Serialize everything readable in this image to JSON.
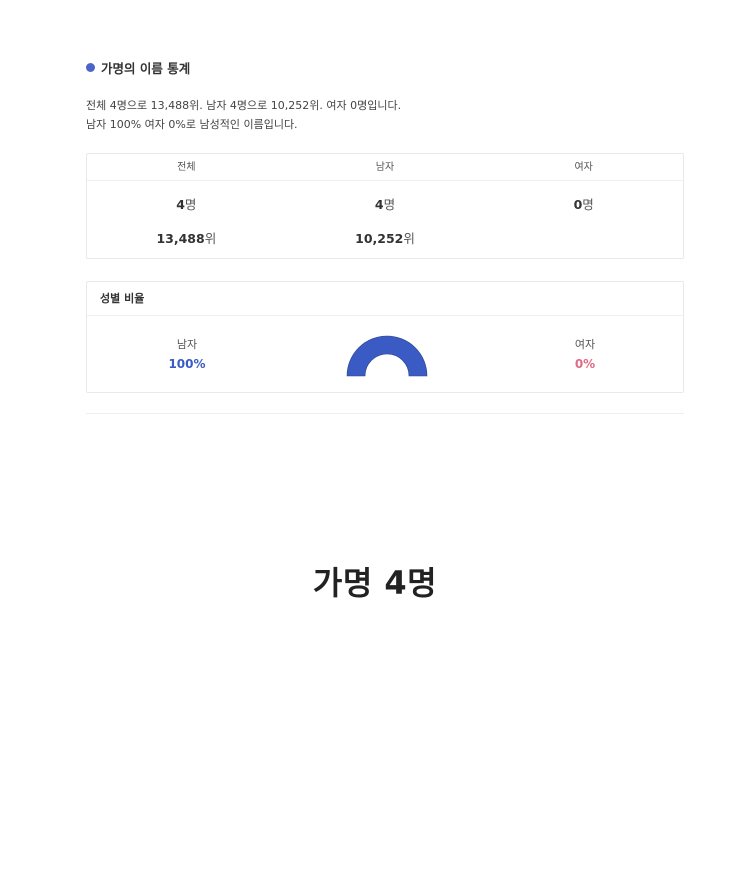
{
  "section": {
    "title": "가명의 이름 통계"
  },
  "summary": {
    "line1": "전체 4명으로 13,488위. 남자 4명으로 10,252위. 여자 0명입니다.",
    "line2": "남자 100% 여자 0%로 남성적인 이름입니다."
  },
  "stats": {
    "headers": [
      "전체",
      "남자",
      "여자"
    ],
    "counts": [
      {
        "num": "4",
        "unit": "명"
      },
      {
        "num": "4",
        "unit": "명"
      },
      {
        "num": "0",
        "unit": "명"
      }
    ],
    "ranks": [
      {
        "num": "13,488",
        "unit": "위"
      },
      {
        "num": "10,252",
        "unit": "위"
      }
    ]
  },
  "ratio": {
    "title": "성별 비율",
    "male_label": "남자",
    "male_pct": "100%",
    "female_label": "여자",
    "female_pct": "0%",
    "male_fraction": 1.0,
    "colors": {
      "male": "#3b5bc4",
      "female": "#e06b83"
    }
  },
  "hero": {
    "title": "가명 4명"
  }
}
